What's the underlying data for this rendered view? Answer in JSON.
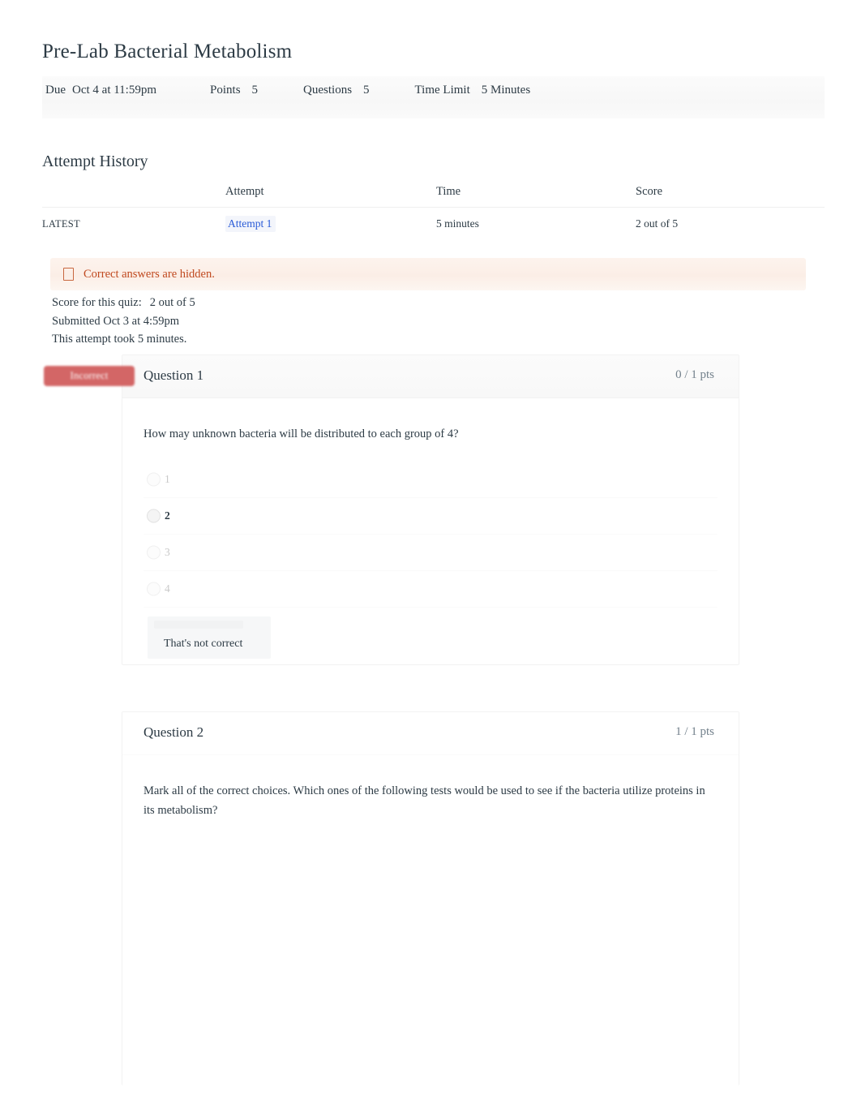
{
  "quiz": {
    "title": "Pre-Lab Bacterial Metabolism",
    "info": {
      "due_label": "Due",
      "due_value": "Oct 4 at 11:59pm",
      "points_label": "Points",
      "points_value": "5",
      "questions_label": "Questions",
      "questions_value": "5",
      "time_limit_label": "Time Limit",
      "time_limit_value": "5 Minutes"
    }
  },
  "attempt_history": {
    "heading": "Attempt History",
    "columns": [
      "",
      "Attempt",
      "Time",
      "Score"
    ],
    "rows": [
      {
        "kept": "LATEST",
        "attempt": "Attempt 1",
        "time": "5 minutes",
        "score": "2 out of 5"
      }
    ]
  },
  "banner": {
    "icon": "warning-icon",
    "text": "Correct answers are hidden."
  },
  "score_summary": {
    "score_label": "Score for this quiz:",
    "score_value": "2 out of 5",
    "submitted": "Submitted Oct 3 at 4:59pm",
    "duration": "This attempt took 5 minutes."
  },
  "questions": [
    {
      "name": "Question 1",
      "points": "0 / 1 pts",
      "status": "Incorrect",
      "text": "How may unknown bacteria will be distributed to each group of 4?",
      "answers": [
        {
          "label": "1",
          "selected": false
        },
        {
          "label": "2",
          "selected": true
        },
        {
          "label": "3",
          "selected": false
        },
        {
          "label": "4",
          "selected": false
        }
      ],
      "feedback": "That's not correct"
    },
    {
      "name": "Question 2",
      "points": "1 / 1 pts",
      "status": "",
      "text": "Mark all of the correct choices. Which ones of the following tests would be used to see if the bacteria utilize proteins in its metabolism?",
      "answers": [],
      "feedback": ""
    }
  ],
  "colors": {
    "link": "#2a5bd7",
    "warning_text": "#c0491f",
    "warning_bg": "#fbeee6",
    "incorrect_badge": "#d05a5a",
    "body_text": "#2d3b45",
    "muted_text": "#73818c"
  }
}
